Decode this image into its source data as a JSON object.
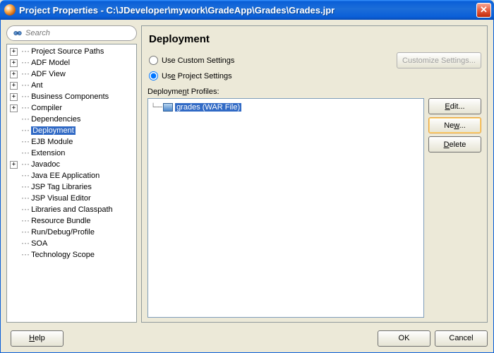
{
  "titlebar": {
    "title": "Project Properties - C:\\JDeveloper\\mywork\\GradeApp\\Grades\\Grades.jpr"
  },
  "search": {
    "placeholder": "Search"
  },
  "tree": {
    "items": [
      {
        "label": "Project Source Paths",
        "expandable": true
      },
      {
        "label": "ADF Model",
        "expandable": true
      },
      {
        "label": "ADF View",
        "expandable": true
      },
      {
        "label": "Ant",
        "expandable": true
      },
      {
        "label": "Business Components",
        "expandable": true
      },
      {
        "label": "Compiler",
        "expandable": true
      },
      {
        "label": "Dependencies",
        "expandable": false
      },
      {
        "label": "Deployment",
        "expandable": false,
        "selected": true
      },
      {
        "label": "EJB Module",
        "expandable": false
      },
      {
        "label": "Extension",
        "expandable": false
      },
      {
        "label": "Javadoc",
        "expandable": true
      },
      {
        "label": "Java EE Application",
        "expandable": false
      },
      {
        "label": "JSP Tag Libraries",
        "expandable": false
      },
      {
        "label": "JSP Visual Editor",
        "expandable": false
      },
      {
        "label": "Libraries and Classpath",
        "expandable": false
      },
      {
        "label": "Resource Bundle",
        "expandable": false
      },
      {
        "label": "Run/Debug/Profile",
        "expandable": false
      },
      {
        "label": "SOA",
        "expandable": false
      },
      {
        "label": "Technology Scope",
        "expandable": false
      }
    ]
  },
  "panel": {
    "heading": "Deployment",
    "custom_label": "Use Custom Settings",
    "project_label_pre": "Us",
    "project_label_u": "e",
    "project_label_post": " Project Settings",
    "customize_btn": "Customize Settings...",
    "profiles_label_pre": "Deployme",
    "profiles_label_u": "n",
    "profiles_label_post": "t Profiles:",
    "profile_item": "grades (WAR File)",
    "buttons": {
      "edit_pre": "",
      "edit_u": "E",
      "edit_post": "dit...",
      "new_pre": "Ne",
      "new_u": "w",
      "new_post": "...",
      "delete_pre": "",
      "delete_u": "D",
      "delete_post": "elete"
    }
  },
  "bottom": {
    "help_u": "H",
    "help_post": "elp",
    "ok": "OK",
    "cancel": "Cancel"
  }
}
